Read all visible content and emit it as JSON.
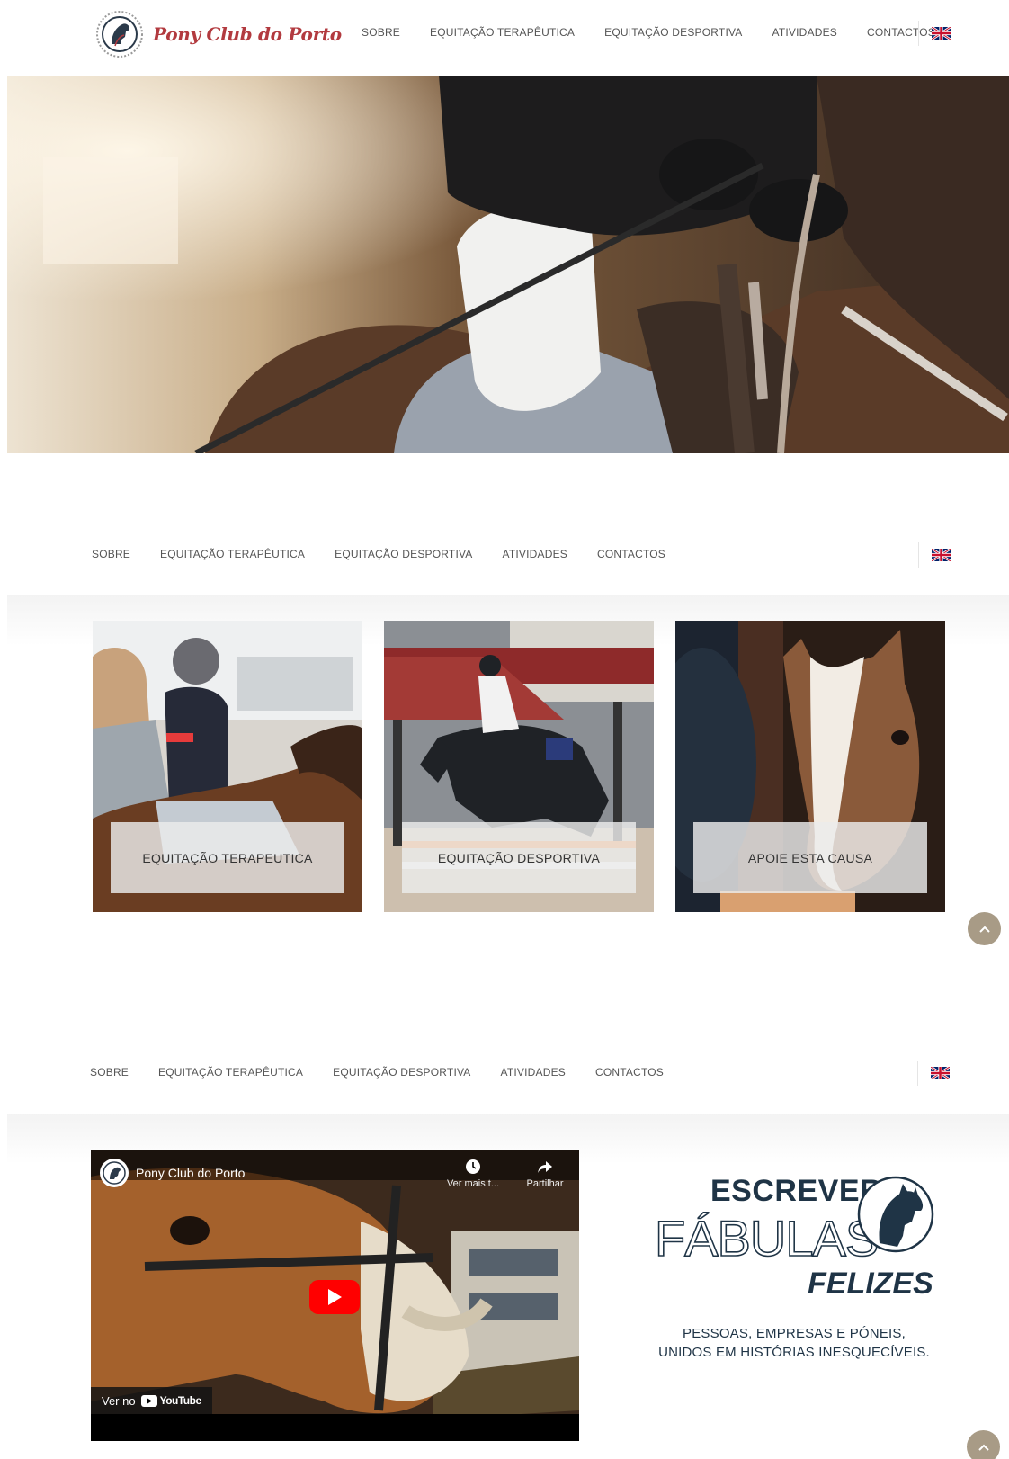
{
  "site": {
    "logo_text": "Pony Club do Porto"
  },
  "nav": {
    "items": [
      "SOBRE",
      "EQUITAÇÃO TERAPÊUTICA",
      "EQUITAÇÃO DESPORTIVA",
      "ATIVIDADES",
      "CONTACTOS"
    ],
    "language_flag": "uk-flag-icon"
  },
  "cards": [
    {
      "label": "EQUITAÇÃO TERAPEUTICA"
    },
    {
      "label": "EQUITAÇÃO DESPORTIVA"
    },
    {
      "label": "APOIE ESTA CAUSA"
    }
  ],
  "video": {
    "channel_title": "Pony Club do Porto",
    "watch_later_label": "Ver mais t...",
    "share_label": "Partilhar",
    "watch_on_label": "Ver no",
    "youtube_label": "YouTube"
  },
  "campaign": {
    "line1": "ESCREVER",
    "line2": "FÁBULAS",
    "line3": "FELIZES",
    "subtitle_line1": "PESSOAS, EMPRESAS E PÓNEIS,",
    "subtitle_line2": "UNIDOS EM HISTÓRIAS INESQUECÍVEIS."
  },
  "colors": {
    "brand_red": "#b23a3f",
    "navy": "#1f3446",
    "scroll_button": "#a89b86",
    "youtube_red": "#ff0000"
  },
  "icons": {
    "scroll_top": "chevron-up-icon",
    "watch_later": "clock-icon",
    "share": "share-icon",
    "play": "play-icon"
  }
}
